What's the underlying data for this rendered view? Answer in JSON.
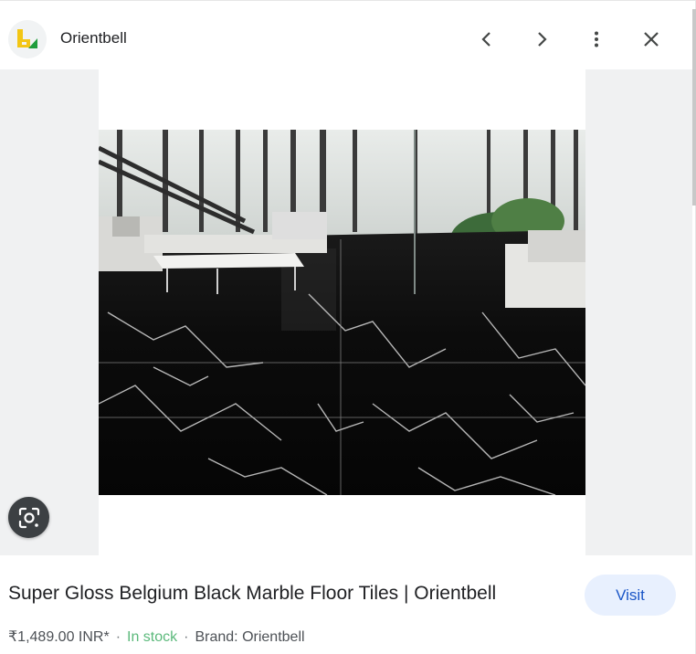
{
  "header": {
    "site_name": "Orientbell",
    "icons": [
      "back-icon",
      "forward-icon",
      "more-vert-icon",
      "close-icon"
    ]
  },
  "image": {
    "lens_icon": "lens-icon"
  },
  "product": {
    "title": "Super Gloss Belgium Black Marble Floor Tiles | Orientbell",
    "visit_label": "Visit",
    "price": "₹1,489.00 INR*",
    "separator": "·",
    "stock": "In stock",
    "brand": "Brand: Orientbell"
  },
  "colors": {
    "visit_bg": "#e8f0fe",
    "visit_text": "#1a56c7",
    "stock_green": "#5bb97b",
    "logo_yellow": "#f3c614",
    "logo_green": "#1f9d3c"
  }
}
